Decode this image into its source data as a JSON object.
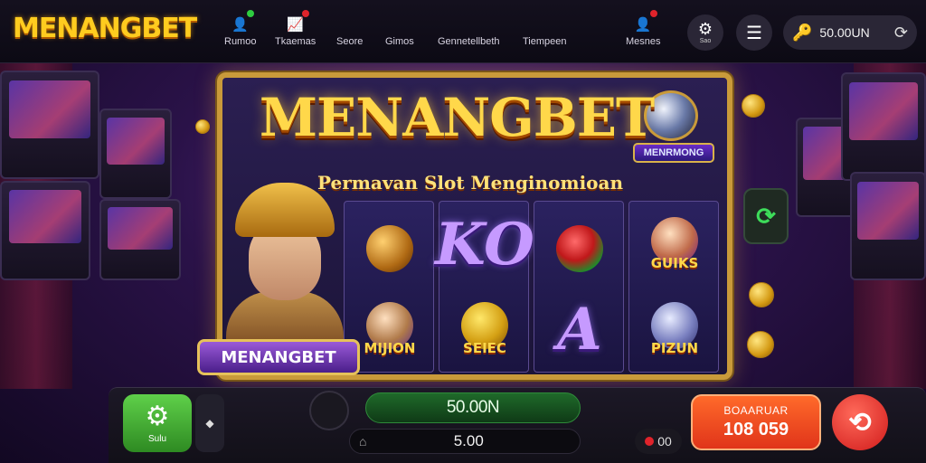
{
  "brand": {
    "logo": "MENANGBET"
  },
  "nav": [
    {
      "label": "Rumoo",
      "icon": "user-plus-icon",
      "dot": "#2ecc40"
    },
    {
      "label": "Tkaemas",
      "icon": "chart-icon",
      "dot": "#e0232b"
    },
    {
      "label": "Seore",
      "icon": "",
      "dot": ""
    },
    {
      "label": "Gimos",
      "icon": "",
      "dot": ""
    },
    {
      "label": "Gennetellbeth",
      "icon": "",
      "dot": ""
    },
    {
      "label": "Tiempeen",
      "icon": "",
      "dot": ""
    },
    {
      "label": "Mesnes",
      "icon": "user-alert-icon",
      "dot": "#e0232b"
    }
  ],
  "header_buttons": {
    "settings_label": "Sao"
  },
  "balance": {
    "value": "50.00UN"
  },
  "game": {
    "title": "MENANGBET",
    "subtitle": "Permavan Slot Menginomioan",
    "badge": "MENRMONG",
    "reels": [
      [
        {
          "kind": "orb",
          "text": ""
        },
        {
          "kind": "orb",
          "text": "MIJION"
        }
      ],
      [
        {
          "kind": "letter",
          "text": "KO"
        },
        {
          "kind": "orb",
          "text": "SEIEC"
        }
      ],
      [
        {
          "kind": "orb",
          "text": ""
        },
        {
          "kind": "letter",
          "text": "A"
        }
      ],
      [
        {
          "kind": "orb",
          "text": "GUIKS"
        },
        {
          "kind": "orb",
          "text": "PIZUN"
        }
      ]
    ],
    "hero_name": "MENANGBET"
  },
  "controls": {
    "spin_label": "Sulu",
    "win_value": "50.00N",
    "bet_value": "5.00",
    "zero_value": "00",
    "total_label": "BOAARUAR",
    "total_value": "108 059"
  },
  "colors": {
    "accent_gold": "#ffcc1f",
    "win_green": "#1f6a2a",
    "spin_green": "#4fbe3a",
    "cta_orange": "#ff5a24",
    "cta_red": "#d01a1a"
  }
}
